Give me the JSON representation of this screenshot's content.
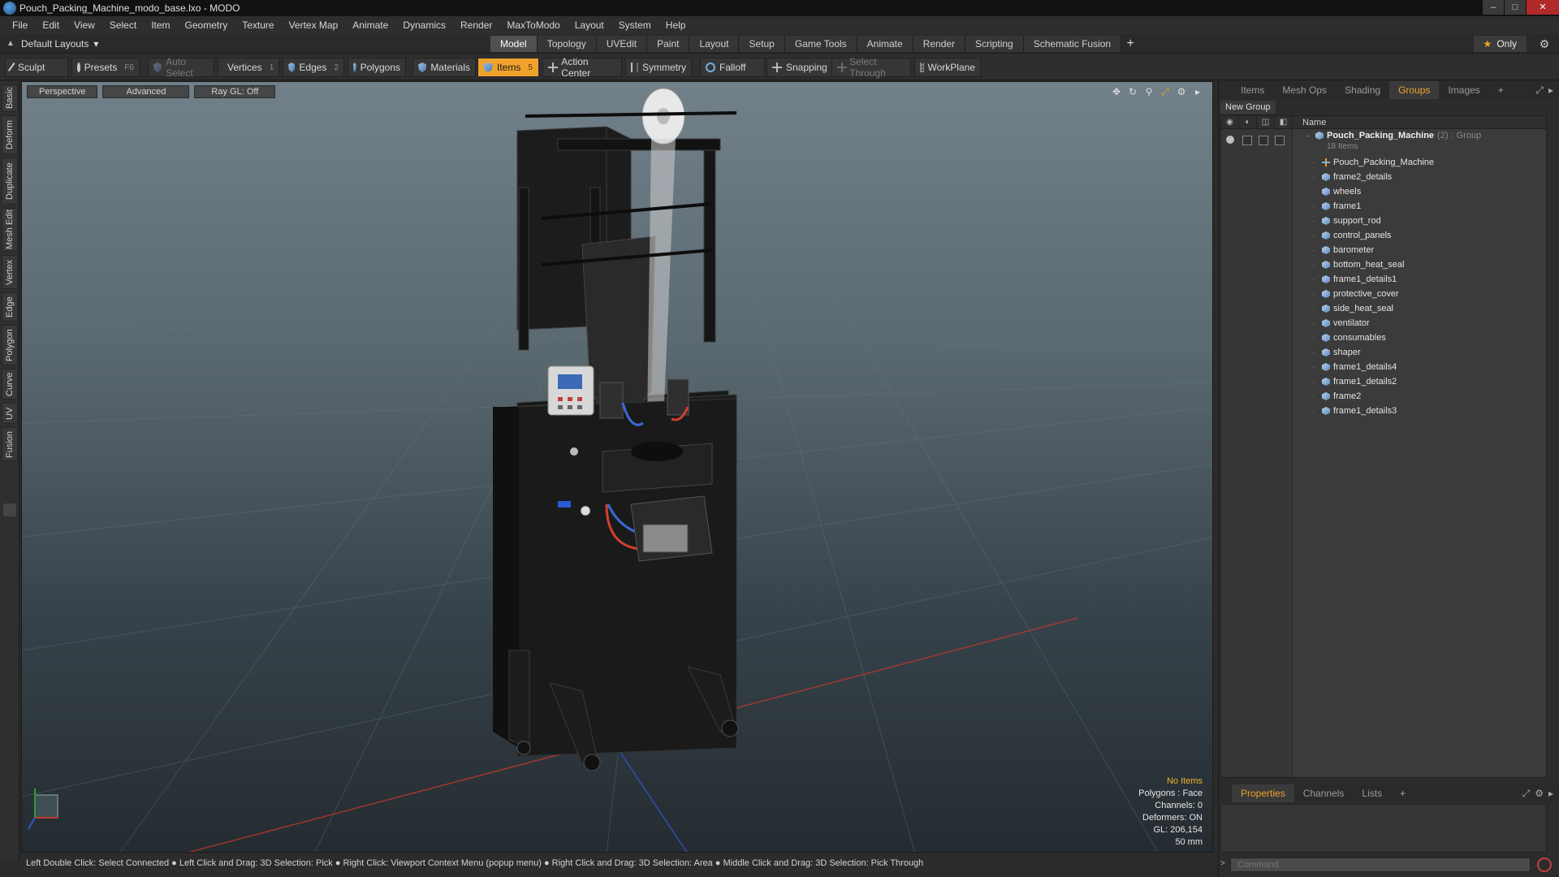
{
  "window": {
    "title": "Pouch_Packing_Machine_modo_base.lxo - MODO",
    "buttons": {
      "minimize": "–",
      "maximize": "□",
      "close": "✕"
    }
  },
  "menu": [
    "File",
    "Edit",
    "View",
    "Select",
    "Item",
    "Geometry",
    "Texture",
    "Vertex Map",
    "Animate",
    "Dynamics",
    "Render",
    "MaxToModo",
    "Layout",
    "System",
    "Help"
  ],
  "layoutbar": {
    "layouts_label": "Default Layouts",
    "tabs": [
      "Model",
      "Topology",
      "UVEdit",
      "Paint",
      "Layout",
      "Setup",
      "Game Tools",
      "Animate",
      "Render",
      "Scripting",
      "Schematic Fusion"
    ],
    "active_tab": "Model",
    "add": "+",
    "only_label": "Only"
  },
  "toolbar": {
    "sculpt": "Sculpt",
    "presets": "Presets",
    "presets_key": "F6",
    "auto_select": "Auto Select",
    "vertices": "Vertices",
    "vertices_count": "1",
    "edges": "Edges",
    "edges_count": "2",
    "polygons": "Polygons",
    "materials": "Materials",
    "items": "Items",
    "items_count": "5",
    "action_center": "Action Center",
    "symmetry": "Symmetry",
    "falloff": "Falloff",
    "snapping": "Snapping",
    "select_through": "Select Through",
    "workplane": "WorkPlane"
  },
  "left_tabs": [
    "Basic",
    "Deform",
    "Duplicate",
    "Mesh Edit",
    "Vertex",
    "Edge",
    "Polygon",
    "Curve",
    "UV",
    "Fusion"
  ],
  "viewport": {
    "view_mode": "Perspective",
    "shading": "Advanced",
    "raygl": "Ray GL: Off",
    "hud": {
      "selection": "No Items",
      "polygons": "Polygons : Face",
      "channels": "Channels: 0",
      "deformers": "Deformers: ON",
      "gl": "GL: 206,154",
      "lens": "50 mm"
    }
  },
  "statusbar": "Left Double Click: Select Connected ● Left Click and Drag: 3D Selection: Pick ● Right Click: Viewport Context Menu (popup menu) ● Right Click and Drag: 3D Selection: Area ● Middle Click and Drag: 3D Selection: Pick Through",
  "right_panel": {
    "tabs": [
      "Items",
      "Mesh Ops",
      "Shading",
      "Groups",
      "Images"
    ],
    "active_tab": "Groups",
    "add": "+",
    "new_group": "New Group",
    "column_name": "Name",
    "group": {
      "name": "Pouch_Packing_Machine",
      "count": "(2)",
      "type": ": Group",
      "sub": "18 Items"
    },
    "items": [
      "Pouch_Packing_Machine",
      "frame2_details",
      "wheels",
      "frame1",
      "support_rod",
      "control_panels",
      "barometer",
      "bottom_heat_seal",
      "frame1_details1",
      "protective_cover",
      "side_heat_seal",
      "ventilator",
      "consumables",
      "shaper",
      "frame1_details4",
      "frame1_details2",
      "frame2",
      "frame1_details3"
    ],
    "bottom_tabs": [
      "Properties",
      "Channels",
      "Lists"
    ],
    "bottom_active": "Properties",
    "command_placeholder": "Command"
  },
  "colors": {
    "accent": "#f0a32c",
    "close": "#b02a2a",
    "background": "#2b2b2b"
  }
}
